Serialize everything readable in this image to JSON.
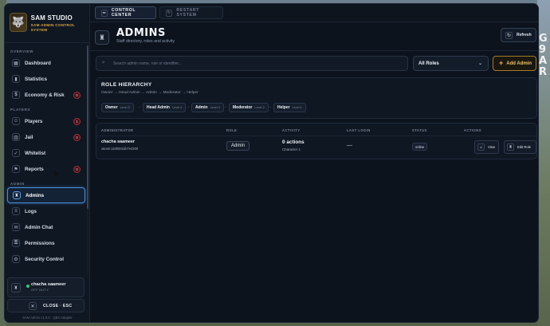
{
  "app": {
    "name": "SAM STUDIO",
    "subtitle": "SAM ADMIN CONTROL SYSTEM",
    "version_text": "SAM Admin v1.0.0 · QBX Adapter"
  },
  "top_tabs": [
    {
      "label": "CONTROL CENTER",
      "icon": "sliders-icon",
      "active": true
    },
    {
      "label": "RESTART SYSTEM",
      "icon": "refresh-icon",
      "active": false
    }
  ],
  "sidebar": {
    "sections": {
      "overview": "OVERVIEW",
      "players": "PLAYERS",
      "admin": "ADMIN"
    },
    "items": [
      {
        "label": "Dashboard",
        "icon": "grid-icon"
      },
      {
        "label": "Statistics",
        "icon": "bar-chart-icon"
      },
      {
        "label": "Economy & Risk",
        "icon": "coin-icon",
        "badge": "0"
      },
      {
        "label": "Players",
        "icon": "users-icon",
        "badge": "1"
      },
      {
        "label": "Jail",
        "icon": "lock-icon",
        "badge": "0"
      },
      {
        "label": "Whitelist",
        "icon": "shield-check-icon"
      },
      {
        "label": "Reports",
        "icon": "flag-icon",
        "badge": "0"
      },
      {
        "label": "Admins",
        "icon": "admin-icon",
        "active": true
      },
      {
        "label": "Logs",
        "icon": "document-icon"
      },
      {
        "label": "Admin Chat",
        "icon": "chat-icon"
      },
      {
        "label": "Permissions",
        "icon": "key-icon"
      },
      {
        "label": "Security Control",
        "icon": "gear-icon"
      }
    ],
    "user": {
      "name": "chacha saameer",
      "status": "OFF DUTY"
    },
    "close_label": "CLOSE · ESC"
  },
  "header": {
    "title": "ADMINS",
    "subtitle": "Staff directory, roles and activity",
    "refresh_label": "Refresh"
  },
  "toolbar": {
    "search_placeholder": "Search admin name, role or identifier...",
    "role_filter": "All Roles",
    "add_label": "Add Admin"
  },
  "hierarchy": {
    "title": "ROLE HIERARCHY",
    "chain": "Owner → Head Admin → Admin → Moderator → Helper",
    "levels": [
      {
        "name": "Owner",
        "level": "Level 5"
      },
      {
        "name": "Head Admin",
        "level": "Level 4"
      },
      {
        "name": "Admin",
        "level": "Level 3"
      },
      {
        "name": "Moderator",
        "level": "Level 2"
      },
      {
        "name": "Helper",
        "level": "Level 1"
      }
    ]
  },
  "table": {
    "columns": [
      "ADMINISTRATOR",
      "ROLE",
      "ACTIVITY",
      "LAST LOGIN",
      "STATUS",
      "ACTIONS"
    ],
    "rows": [
      {
        "name": "chacha saameer",
        "identifier": "steam:1100001bb7e4300",
        "role": "Admin",
        "activity": "0 actions",
        "activity_sub": "Character 1",
        "last_login": "—",
        "status": "online",
        "actions": [
          "View",
          "Edit Role"
        ]
      }
    ]
  },
  "colors": {
    "accent_blue": "#4a8fd9",
    "accent_gold": "#f0b74a",
    "badge_red": "#a8323c",
    "online_green": "#3dc46e"
  }
}
